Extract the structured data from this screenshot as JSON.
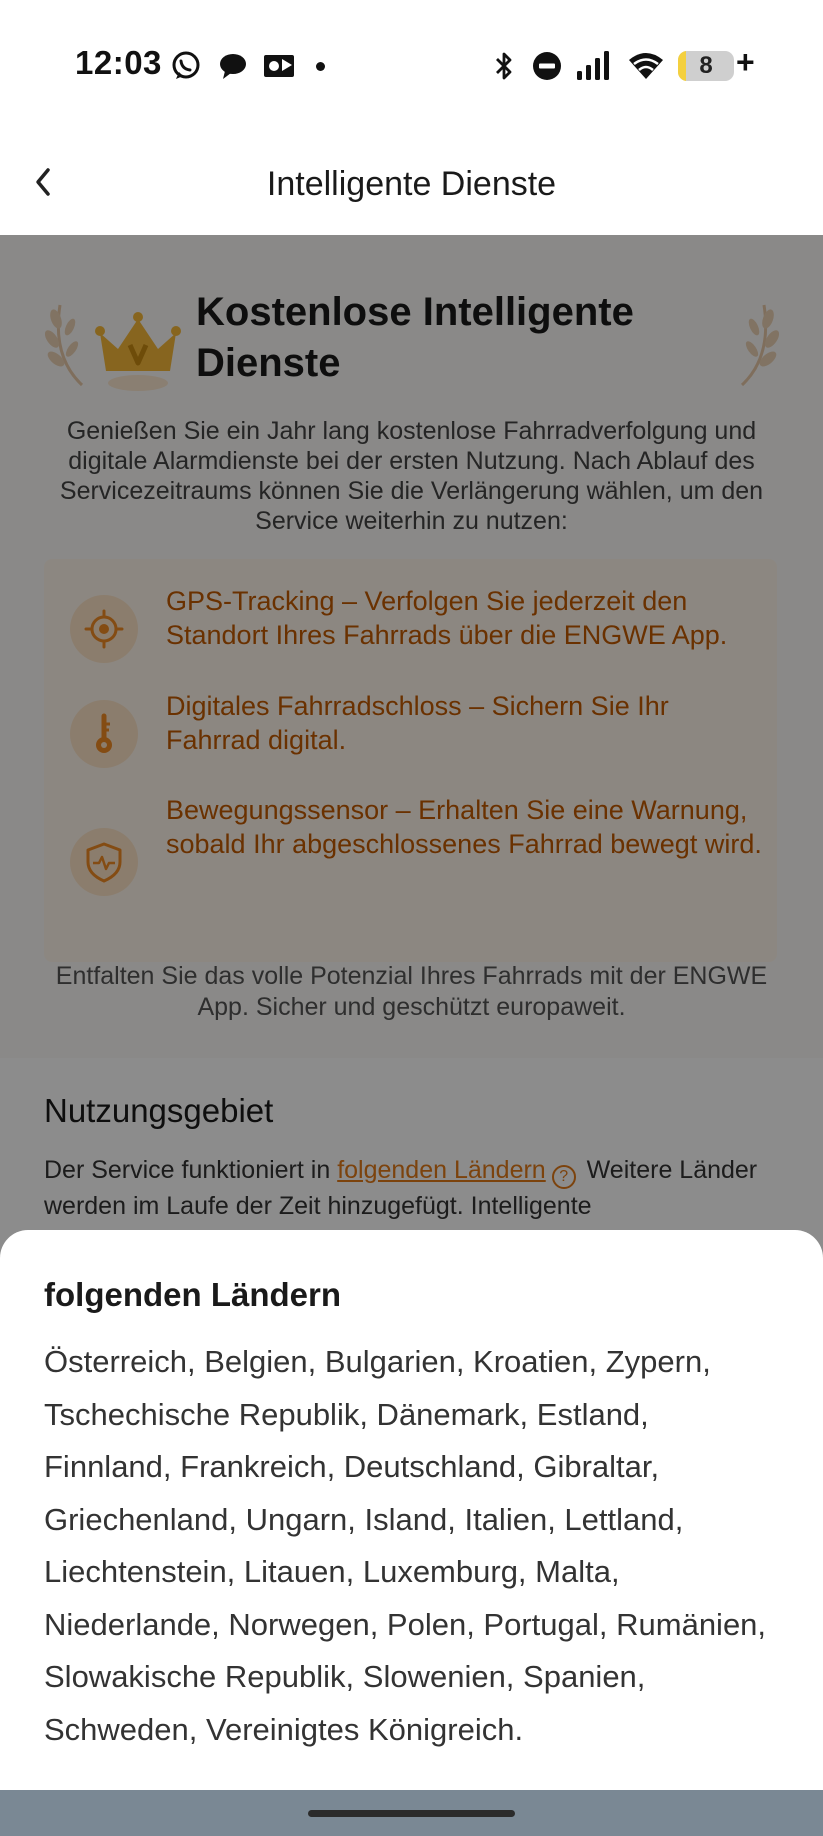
{
  "status_bar": {
    "time": "12:03",
    "battery_level": "8",
    "battery_fraction": 0.08,
    "icons": [
      "whatsapp-icon",
      "chat-bubble-icon",
      "outlook-icon",
      "notification-dot-icon",
      "bluetooth-icon",
      "do-not-disturb-icon",
      "signal-icon",
      "wifi-icon",
      "battery-icon"
    ]
  },
  "header": {
    "title": "Intelligente Dienste",
    "back_icon": "chevron-left-icon"
  },
  "hero": {
    "title": "Kostenlose Intelligente Dienste",
    "description": "Genießen Sie ein Jahr lang kostenlose Fahrradverfolgung und digitale Alarmdienste bei der ersten Nutzung. Nach Ablauf des Servicezeitraums können Sie die Verlängerung wählen, um den Service weiterhin zu nutzen:",
    "features": [
      {
        "icon": "gps-target-icon",
        "text": "GPS-Tracking – Verfolgen Sie jederzeit den Standort Ihres Fahrrads über die ENGWE App."
      },
      {
        "icon": "key-icon",
        "text": "Digitales Fahrradschloss – Sichern Sie Ihr Fahrrad digital."
      },
      {
        "icon": "shield-pulse-icon",
        "text": "Bewegungssensor – Erhalten Sie eine Warnung, sobald Ihr abgeschlossenes Fahrrad bewegt wird."
      }
    ],
    "footer": "Entfalten Sie das volle Potenzial Ihres Fahrrads mit der ENGWE App. Sicher und geschützt europaweit."
  },
  "usage": {
    "title": "Nutzungsgebiet",
    "text_before": "Der Service funktioniert in ",
    "link": "folgenden Ländern",
    "help_icon": "question-circle-icon",
    "text_after": " Weitere Länder werden im Laufe der Zeit hinzugefügt. Intelligente"
  },
  "sheet": {
    "title": "folgenden Ländern",
    "countries": "Österreich, Belgien, Bulgarien, Kroatien, Zypern, Tschechische Republik, Dänemark, Estland, Finnland, Frankreich, Deutschland, Gibraltar, Griechenland, Ungarn, Island, Italien, Lettland, Liechtenstein, Litauen, Luxemburg, Malta, Niederlande, Norwegen, Polen, Portugal, Rumänien, Slowakische Republik, Slowenien, Spanien, Schweden, Vereinigtes Königreich."
  },
  "colors": {
    "accent": "#e27a18",
    "feature_text": "#c25a00",
    "feature_bg": "#fff6ec",
    "overlay": "rgba(0,0,0,0.45)"
  }
}
